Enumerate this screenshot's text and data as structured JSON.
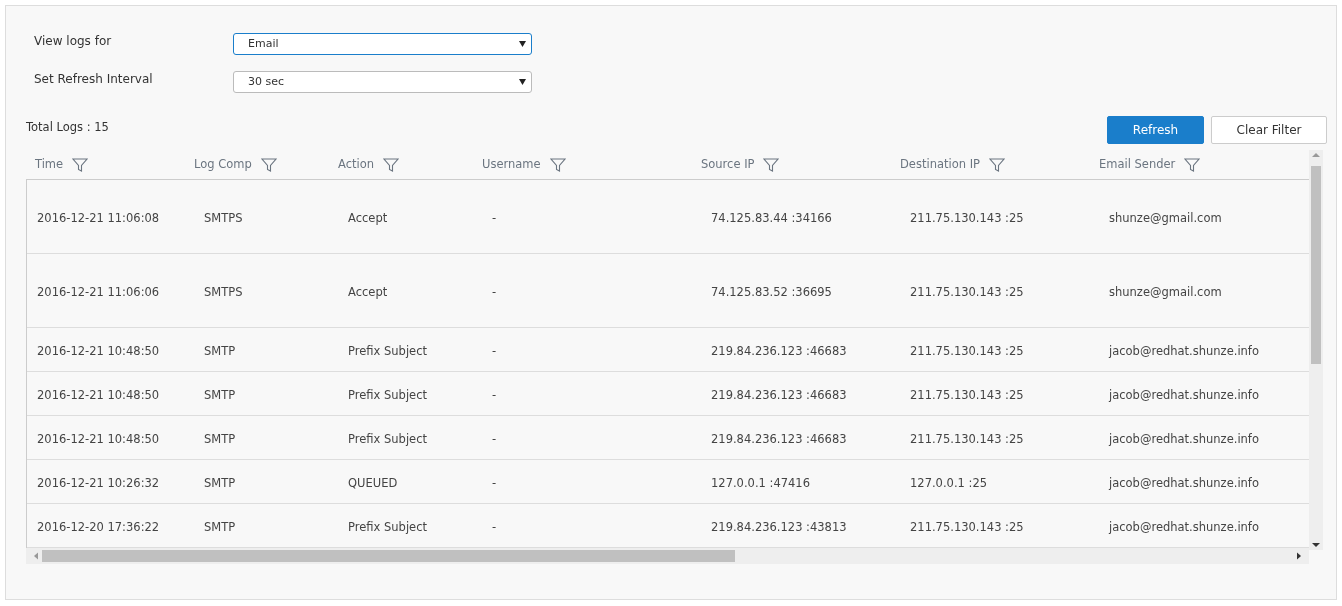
{
  "filters": [
    {
      "label": "View logs for",
      "value": "Email",
      "focused": true
    },
    {
      "label": "Set Refresh Interval",
      "value": "30 sec",
      "focused": false
    }
  ],
  "total_logs": "Total Logs : 15",
  "buttons": [
    {
      "label": "Refresh",
      "kind": "primary"
    },
    {
      "label": "Clear Filter",
      "kind": "secondary"
    }
  ],
  "table": {
    "columns": [
      "Time",
      "Log Comp",
      "Action",
      "Username",
      "Source IP",
      "Destination IP",
      "Email Sender"
    ],
    "rows": [
      [
        "2016-12-21 11:06:08",
        "SMTPS",
        "Accept",
        "-",
        "74.125.83.44 :34166",
        "211.75.130.143 :25",
        "shunze@gmail.com"
      ],
      [
        "2016-12-21 11:06:06",
        "SMTPS",
        "Accept",
        "-",
        "74.125.83.52 :36695",
        "211.75.130.143 :25",
        "shunze@gmail.com"
      ],
      [
        "2016-12-21 10:48:50",
        "SMTP",
        "Prefix Subject",
        "-",
        "219.84.236.123 :46683",
        "211.75.130.143 :25",
        "jacob@redhat.shunze.info"
      ],
      [
        "2016-12-21 10:48:50",
        "SMTP",
        "Prefix Subject",
        "-",
        "219.84.236.123 :46683",
        "211.75.130.143 :25",
        "jacob@redhat.shunze.info"
      ],
      [
        "2016-12-21 10:48:50",
        "SMTP",
        "Prefix Subject",
        "-",
        "219.84.236.123 :46683",
        "211.75.130.143 :25",
        "jacob@redhat.shunze.info"
      ],
      [
        "2016-12-21 10:26:32",
        "SMTP",
        "QUEUED",
        "-",
        "127.0.0.1 :47416",
        "127.0.0.1 :25",
        "jacob@redhat.shunze.info"
      ],
      [
        "2016-12-20 17:36:22",
        "SMTP",
        "Prefix Subject",
        "-",
        "219.84.236.123 :43813",
        "211.75.130.143 :25",
        "jacob@redhat.shunze.info"
      ]
    ]
  }
}
